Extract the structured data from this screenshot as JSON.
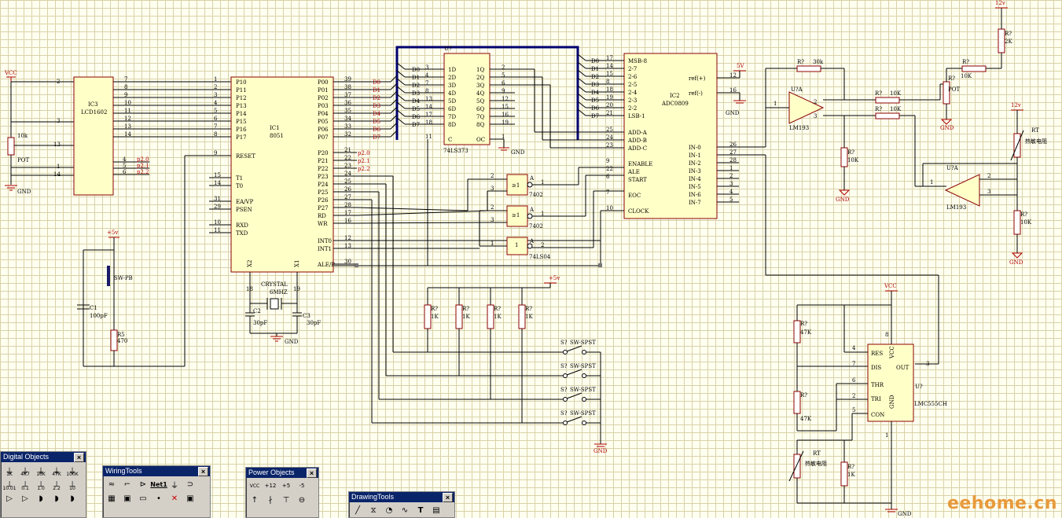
{
  "schematic": {
    "ic3": {
      "ref": "IC3",
      "name": "LCD1602"
    },
    "ic1": {
      "ref": "IC1",
      "name": "8051",
      "left_pins": [
        "P10",
        "P11",
        "P12",
        "P13",
        "P14",
        "P15",
        "P16",
        "P17",
        "RESET",
        "T1",
        "T0",
        "EA/VP",
        "PSEN",
        "RXD",
        "TXD"
      ],
      "left_nums": [
        "1",
        "2",
        "3",
        "4",
        "5",
        "6",
        "7",
        "8",
        "9",
        "15",
        "14",
        "31",
        "29",
        "10",
        "11"
      ],
      "right_pins": [
        "P00",
        "P01",
        "P02",
        "P03",
        "P04",
        "P05",
        "P06",
        "P07",
        "P20",
        "P21",
        "P22",
        "P23",
        "P24",
        "P25",
        "P26",
        "P27",
        "RD",
        "WR",
        "INT0",
        "INT1",
        "ALE/P"
      ],
      "right_nums": [
        "39",
        "38",
        "37",
        "36",
        "35",
        "34",
        "33",
        "32",
        "21",
        "22",
        "23",
        "24",
        "25",
        "26",
        "27",
        "28",
        "17",
        "16",
        "12",
        "13",
        "30"
      ],
      "bottom": [
        "X2",
        "X1"
      ]
    },
    "u7": {
      "ref": "U7",
      "name": "74LS373",
      "in_pins": [
        "1D",
        "2D",
        "3D",
        "4D",
        "5D",
        "6D",
        "7D",
        "8D"
      ],
      "out_pins": [
        "1Q",
        "2Q",
        "3Q",
        "4Q",
        "5Q",
        "6Q",
        "7Q",
        "8Q"
      ],
      "in_nums": [
        "3",
        "4",
        "7",
        "8",
        "13",
        "14",
        "17",
        "18"
      ],
      "out_nums": [
        "2",
        "5",
        "6",
        "9",
        "12",
        "15",
        "16",
        "19"
      ],
      "c_label": "C",
      "oe_label": "OC",
      "c_num": "11",
      "oe_num": "1"
    },
    "ic2": {
      "ref": "IC2",
      "name": "ADC0809",
      "left_pins": [
        "MSB-8",
        "2-7",
        "2-6",
        "2-5",
        "2-4",
        "2-3",
        "2-2",
        "LSB-1",
        "ADD-A",
        "ADD-B",
        "ADD-C",
        "ENABLE",
        "ALE",
        "START",
        "EOC",
        "CLOCK"
      ],
      "left_nums": [
        "17",
        "14",
        "15",
        "8",
        "18",
        "19",
        "20",
        "21",
        "25",
        "24",
        "23",
        "9",
        "22",
        "6",
        "7",
        "10"
      ],
      "right_pins": [
        "ref(+)",
        "ref(-)",
        "IN-0",
        "IN-1",
        "IN-2",
        "IN-3",
        "IN-4",
        "IN-5",
        "IN-6",
        "IN-7"
      ],
      "right_nums": [
        "12",
        "16",
        "26",
        "27",
        "28",
        "1",
        "2",
        "3",
        "4",
        "5"
      ]
    },
    "data_labels": [
      "D0",
      "D1",
      "D2",
      "D3",
      "D4",
      "D5",
      "D6",
      "D7"
    ],
    "p2_labels": [
      "p2.0",
      "p2.1",
      "p2.2"
    ],
    "gates": {
      "g1": "7402",
      "g2": "7402",
      "g3": "74LS04",
      "nor": "≥1",
      "inv": "1",
      "a": "A"
    },
    "opamps": {
      "u1": "U?A",
      "u2": "U?A",
      "model": "LM193"
    },
    "lmc": {
      "ref": "U?",
      "name": "LMC555CH",
      "pins": [
        "RES",
        "DIS",
        "THR",
        "TRI",
        "CON",
        "OUT",
        "VCC",
        "GND"
      ],
      "nums": [
        "4",
        "7",
        "6",
        "2",
        "5",
        "3",
        "8",
        "1"
      ]
    },
    "res_labels": {
      "r": "R?",
      "r1k": "1K",
      "r10k": "10K",
      "r30k": "30k",
      "r47k": "47K",
      "r2k": "2K",
      "pot": "POT",
      "r5": "R5",
      "r470": "470",
      "rt": "RT",
      "rt_name": "热敏电阻"
    },
    "caps": {
      "c1": "C1",
      "c1v": "100pF",
      "c2": "C2",
      "c2v": "30pF",
      "c3": "C3",
      "c3v": "30pF"
    },
    "crystal": {
      "name": "CRYSTAL",
      "freq": "6MHZ"
    },
    "switches": {
      "sw_pb": "SW-PB",
      "sw_spst": "SW-SPST",
      "sq": "S?"
    },
    "power": {
      "vcc": "VCC",
      "gnd": "GND",
      "v5": "5V",
      "p5v": "+5v",
      "v12": "12v",
      "ten_k": "10k",
      "pot": "POT"
    },
    "pin_misc": {
      "n2": "2",
      "n3": "3",
      "n1": "1",
      "n4": "4",
      "n5": "5",
      "n6": "6",
      "n7": "7",
      "n8": "8",
      "n9": "9",
      "n10": "10",
      "n11": "11",
      "n12": "12",
      "n13": "13",
      "n14": "14",
      "n16": "16",
      "n17": "17",
      "n18": "18",
      "n19": "19"
    }
  },
  "toolbars": {
    "digital": {
      "title": "Digital Objects",
      "items": [
        "1K",
        "4K7",
        "10K",
        "47K",
        "100K",
        "10.01",
        "0.1",
        "1.0",
        "2.2",
        "10"
      ]
    },
    "wiring": {
      "title": "WiringTools",
      "items": [
        "Net1"
      ]
    },
    "power": {
      "title": "Power Objects",
      "items": [
        "VCC",
        "+12",
        "+5",
        "-5"
      ]
    },
    "drawing": {
      "title": "DrawingTools",
      "items": [
        "T"
      ]
    }
  },
  "watermark": "eehome.cn"
}
